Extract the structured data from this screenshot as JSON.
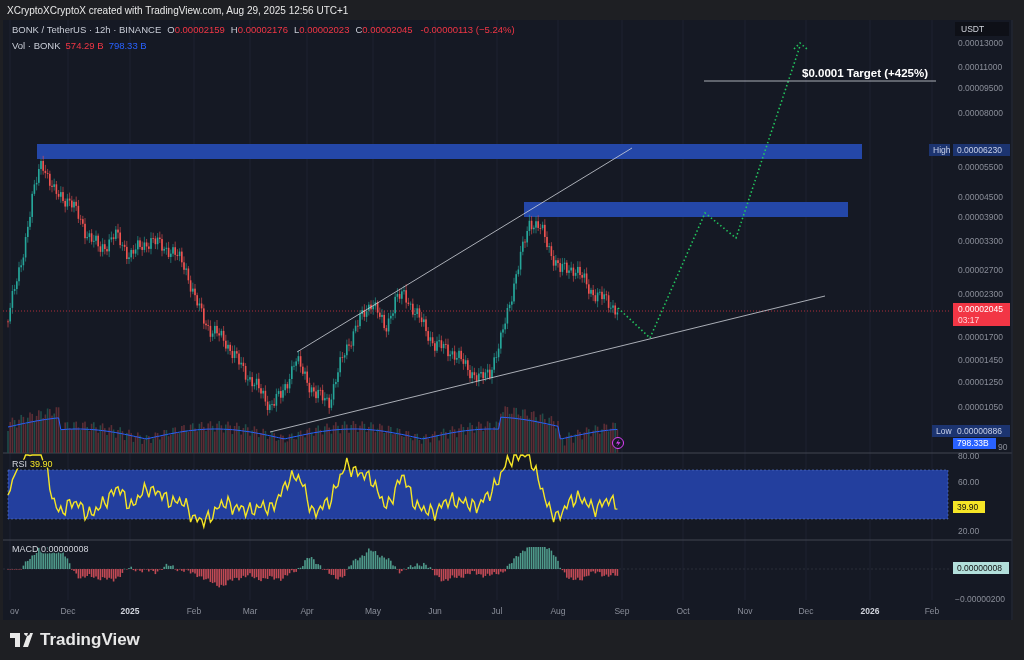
{
  "snapshot_caption": "XCryptoXCryptoX created with TradingView.com, Aug 29, 2025 12:56 UTC+1",
  "legend": {
    "symbol": "BONK / TetherUS · 12h · BINANCE",
    "ohlc": [
      {
        "letter": "O",
        "value": "0.00002159"
      },
      {
        "letter": "H",
        "value": "0.00002176"
      },
      {
        "letter": "L",
        "value": "0.00002023"
      },
      {
        "letter": "C",
        "value": "0.00002045"
      }
    ],
    "change": "-0.00000113 (−5.24%)",
    "volume": {
      "label": "Vol · BONK",
      "values": [
        {
          "text": "574.29 B",
          "color": "#f23645"
        },
        {
          "text": "798.33 B",
          "color": "#2962ff"
        }
      ]
    }
  },
  "price_axis": {
    "currency": "USDT",
    "labels": [
      "0.00013000",
      "0.00011000",
      "0.00009500",
      "0.00008000",
      "0.00005500",
      "0.00004500",
      "0.00003900",
      "0.00003300",
      "0.00002700",
      "0.00002300",
      "0.00001700",
      "0.00001450",
      "0.00001250",
      "0.00001050"
    ],
    "high": {
      "tag": "High",
      "value": "0.00006230"
    },
    "low": {
      "tag": "Low",
      "value": "0.00000886"
    },
    "last_price": {
      "value": "0.00002045",
      "countdown": "03:17"
    },
    "volume_tag": "798.33B",
    "partial_label": "90"
  },
  "annotation": {
    "target": "$0.0001 Target (+425%)"
  },
  "rsi": {
    "label": "RSI",
    "value": "39.90",
    "axis": [
      "80.00",
      "60.00",
      "20.00"
    ],
    "tag": "39.90"
  },
  "macd": {
    "label": "MACD",
    "value": "0.00000008",
    "tag": "0.00000008",
    "axis": [
      "−0.00000200"
    ]
  },
  "time_axis": [
    {
      "label": "ov",
      "bold": false
    },
    {
      "label": "Dec",
      "bold": false
    },
    {
      "label": "2025",
      "bold": true
    },
    {
      "label": "Feb",
      "bold": false
    },
    {
      "label": "Mar",
      "bold": false
    },
    {
      "label": "Apr",
      "bold": false
    },
    {
      "label": "May",
      "bold": false
    },
    {
      "label": "Jun",
      "bold": false
    },
    {
      "label": "Jul",
      "bold": false
    },
    {
      "label": "Aug",
      "bold": false
    },
    {
      "label": "Sep",
      "bold": false
    },
    {
      "label": "Oct",
      "bold": false
    },
    {
      "label": "Nov",
      "bold": false
    },
    {
      "label": "Dec",
      "bold": false
    },
    {
      "label": "2026",
      "bold": true
    },
    {
      "label": "Feb",
      "bold": false
    }
  ],
  "footer": {
    "brand": "TradingView"
  }
}
